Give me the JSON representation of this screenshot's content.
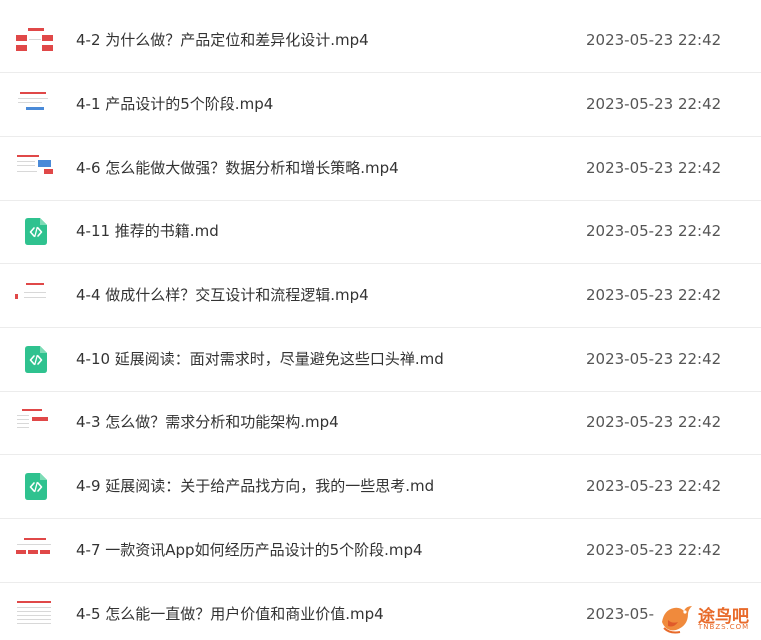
{
  "files": [
    {
      "name": "4-2 为什么做？产品定位和差异化设计.mp4",
      "date": "2023-05-23 22:42",
      "icon": "video-thumbnail-icon"
    },
    {
      "name": "4-1 产品设计的5个阶段.mp4",
      "date": "2023-05-23 22:42",
      "icon": "video-thumbnail-icon"
    },
    {
      "name": "4-6 怎么能做大做强？数据分析和增长策略.mp4",
      "date": "2023-05-23 22:42",
      "icon": "video-thumbnail-icon"
    },
    {
      "name": "4-11 推荐的书籍.md",
      "date": "2023-05-23 22:42",
      "icon": "markdown-file-icon"
    },
    {
      "name": "4-4 做成什么样？交互设计和流程逻辑.mp4",
      "date": "2023-05-23 22:42",
      "icon": "video-thumbnail-icon"
    },
    {
      "name": "4-10 延展阅读：面对需求时，尽量避免这些口头禅.md",
      "date": "2023-05-23 22:42",
      "icon": "markdown-file-icon"
    },
    {
      "name": "4-3 怎么做？需求分析和功能架构.mp4",
      "date": "2023-05-23 22:42",
      "icon": "video-thumbnail-icon"
    },
    {
      "name": "4-9 延展阅读：关于给产品找方向，我的一些思考.md",
      "date": "2023-05-23 22:42",
      "icon": "markdown-file-icon"
    },
    {
      "name": "4-7 一款资讯App如何经历产品设计的5个阶段.mp4",
      "date": "2023-05-23 22:42",
      "icon": "video-thumbnail-icon"
    },
    {
      "name": "4-5 怎么能一直做？用户价值和商业价值.mp4",
      "date": "2023-05-",
      "icon": "video-thumbnail-icon"
    }
  ],
  "watermark": {
    "text": "途鸟吧",
    "sub": "TNBZS.COM"
  },
  "colors": {
    "md_icon": "#2fc28f",
    "thumb_red": "#e04848",
    "divider": "#ececec"
  }
}
